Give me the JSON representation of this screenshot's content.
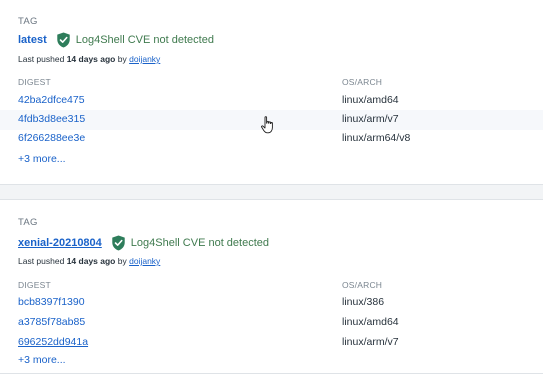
{
  "tags": [
    {
      "section_label": "TAG",
      "name": "latest",
      "cve_status": "Log4Shell CVE not detected",
      "pushed_prefix": "Last pushed",
      "pushed_age": "14 days ago",
      "pushed_by": "by",
      "pushed_user": "doijanky",
      "digest_header": "DIGEST",
      "osarch_header": "OS/ARCH",
      "rows": [
        {
          "digest": "42ba2dfce475",
          "arch": "linux/amd64"
        },
        {
          "digest": "4fdb3d8ee315",
          "arch": "linux/arm/v7"
        },
        {
          "digest": "6f266288ee3e",
          "arch": "linux/arm64/v8"
        }
      ],
      "more": "+3 more..."
    },
    {
      "section_label": "TAG",
      "name": "xenial-20210804",
      "cve_status": "Log4Shell CVE not detected",
      "pushed_prefix": "Last pushed",
      "pushed_age": "14 days ago",
      "pushed_by": "by",
      "pushed_user": "doijanky",
      "digest_header": "DIGEST",
      "osarch_header": "OS/ARCH",
      "rows": [
        {
          "digest": "bcb8397f1390",
          "arch": "linux/386"
        },
        {
          "digest": "a3785f78ab85",
          "arch": "linux/amd64"
        },
        {
          "digest": "696252dd941a",
          "arch": "linux/arm/v7"
        }
      ],
      "more": "+3 more..."
    }
  ],
  "colors": {
    "link": "#1a62c9",
    "shield": "#2e7d5b",
    "cve_text": "#3f7a4e"
  },
  "icons": {
    "shield": "shield-check-icon",
    "cursor": "hand-pointer-icon"
  }
}
